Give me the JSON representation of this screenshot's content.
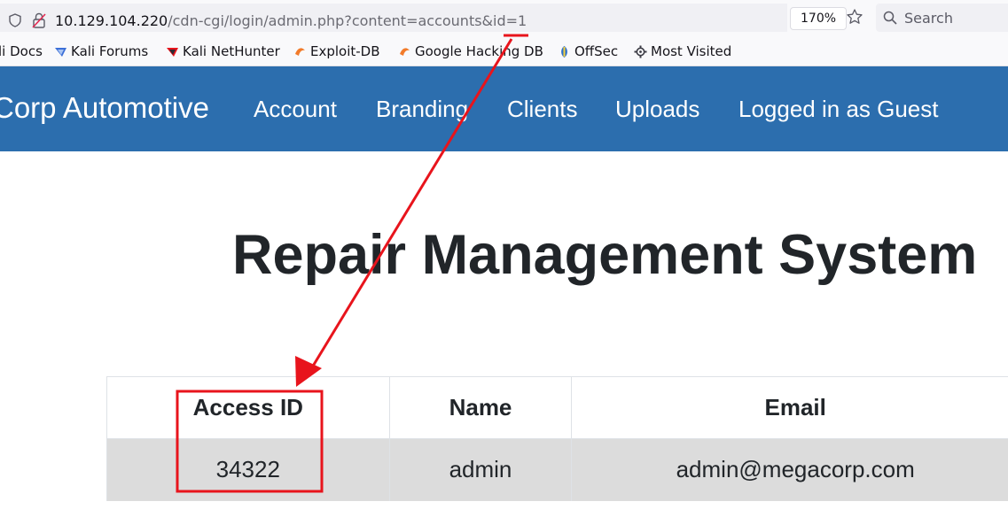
{
  "browser": {
    "url_host": "10.129.104.220",
    "url_path": "/cdn-cgi/login/admin.php?content=accounts&id=1",
    "zoom": "170%",
    "search_placeholder": "Search",
    "bookmarks": [
      {
        "label": "li Docs",
        "icon": "kali-docs-icon"
      },
      {
        "label": "Kali Forums",
        "icon": "kali-forums-icon"
      },
      {
        "label": "Kali NetHunter",
        "icon": "kali-nethunter-icon"
      },
      {
        "label": "Exploit-DB",
        "icon": "exploit-db-icon"
      },
      {
        "label": "Google Hacking DB",
        "icon": "google-hacking-db-icon"
      },
      {
        "label": "OffSec",
        "icon": "offsec-icon"
      },
      {
        "label": "Most Visited",
        "icon": "gear-icon"
      }
    ]
  },
  "navbar": {
    "brand": "Corp Automotive",
    "links": [
      "Account",
      "Branding",
      "Clients",
      "Uploads",
      "Logged in as Guest"
    ],
    "color": "#2c6eae"
  },
  "main": {
    "heading": "Repair Management System",
    "table": {
      "headers": [
        "Access ID",
        "Name",
        "Email"
      ],
      "rows": [
        [
          "34322",
          "admin",
          "admin@megacorp.com"
        ]
      ]
    }
  },
  "annotation": {
    "color": "#e8141c"
  }
}
